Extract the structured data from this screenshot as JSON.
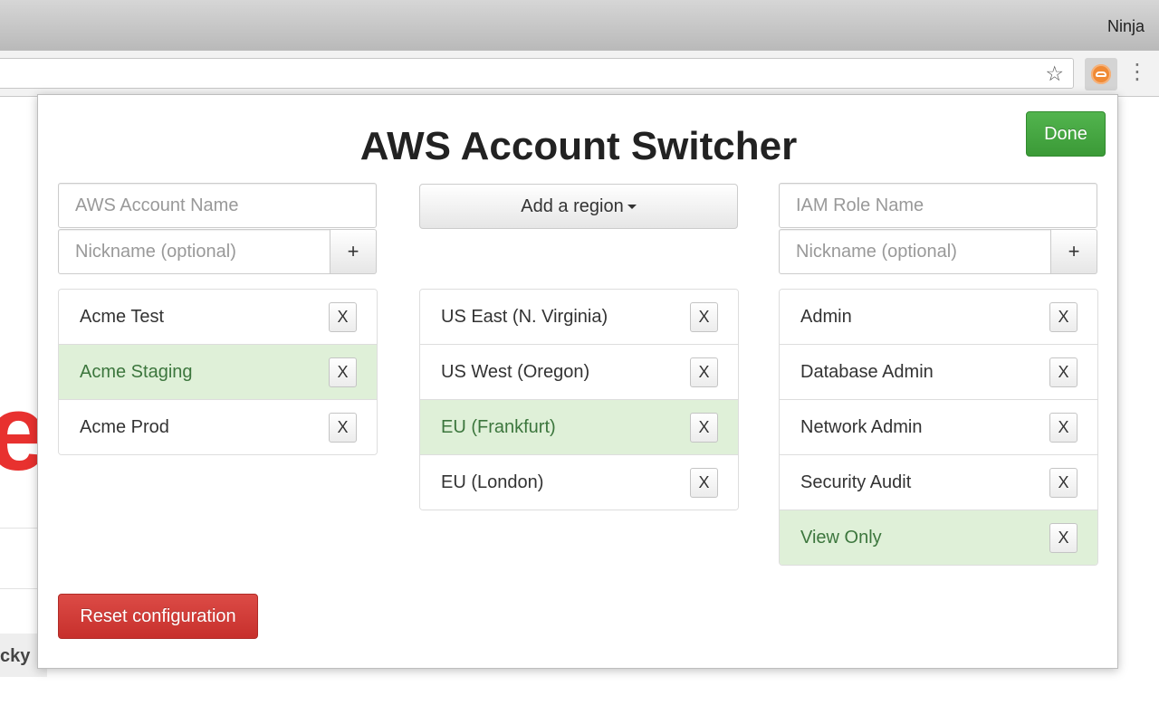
{
  "browser": {
    "profile_name": "Ninja",
    "star_icon": "star-icon",
    "extension_icon": "cloud-icon",
    "menu_icon": "kebab-menu-icon"
  },
  "background_page": {
    "partial_letter": "e",
    "partial_tab_text": "cky"
  },
  "popup": {
    "title": "AWS Account Switcher",
    "done_label": "Done",
    "reset_label": "Reset configuration",
    "accounts": {
      "name_placeholder": "AWS Account Name",
      "nickname_placeholder": "Nickname (optional)",
      "add_label": "+",
      "items": [
        {
          "label": "Acme Test",
          "remove": "X"
        },
        {
          "label": "Acme Staging",
          "remove": "X"
        },
        {
          "label": "Acme Prod",
          "remove": "X"
        }
      ]
    },
    "regions": {
      "add_label": "Add a region",
      "items": [
        {
          "label": "US East (N. Virginia)",
          "remove": "X"
        },
        {
          "label": "US West (Oregon)",
          "remove": "X"
        },
        {
          "label": "EU (Frankfurt)",
          "remove": "X"
        },
        {
          "label": "EU (London)",
          "remove": "X"
        }
      ]
    },
    "roles": {
      "name_placeholder": "IAM Role Name",
      "nickname_placeholder": "Nickname (optional)",
      "add_label": "+",
      "items": [
        {
          "label": "Admin",
          "remove": "X"
        },
        {
          "label": "Database Admin",
          "remove": "X"
        },
        {
          "label": "Network Admin",
          "remove": "X"
        },
        {
          "label": "Security Audit",
          "remove": "X"
        },
        {
          "label": "View Only",
          "remove": "X"
        }
      ]
    }
  },
  "colors": {
    "active_row": "#dff0d8",
    "active_text": "#3c763d",
    "done_button": "#47a843",
    "reset_button": "#d23d38"
  }
}
